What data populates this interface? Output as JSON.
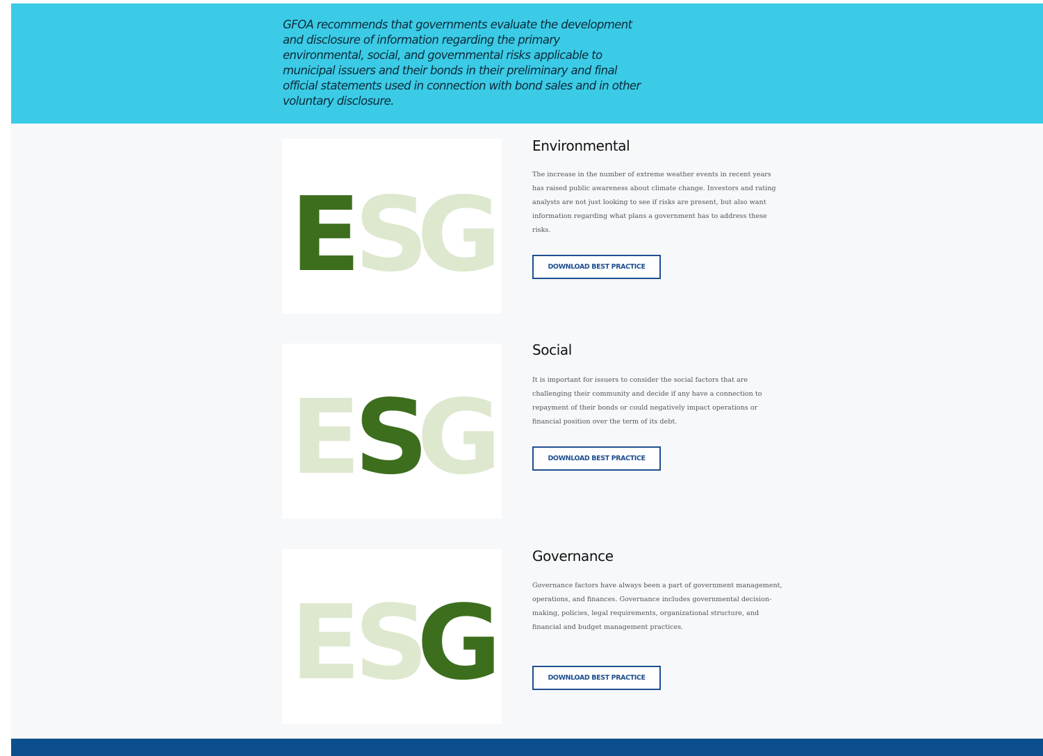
{
  "banner": {
    "text": "GFOA recommends that governments evaluate the development and disclosure of information regarding the primary environmental, social, and governmental risks applicable to municipal issuers and their bonds in their preliminary and final official statements used in connection with bond sales and in other voluntary disclosure."
  },
  "colors": {
    "banner_bg": "#3bcbe6",
    "content_bg": "#f6f8fa",
    "footer_bg": "#0c4f8c",
    "button_border": "#1e4f8f",
    "leaf_dark": "#3d6e1e",
    "leaf_light": "#dde8cf"
  },
  "sections": [
    {
      "title": "Environmental",
      "body": "The increase in the number of extreme weather events in recent years has raised public awareness about climate change. Investors and rating analysts are not just looking to see if risks are present, but also want information regarding what plans a government has to address these risks.",
      "button_label": "DOWNLOAD BEST PRACTICE",
      "image": {
        "letters": [
          "E",
          "S",
          "G"
        ],
        "highlighted_letter": "E"
      }
    },
    {
      "title": "Social",
      "body": "It is important for issuers to consider the social factors that are challenging their community and decide if any have a connection to repayment of their bonds or could negatively impact operations or financial position over the term of its debt.",
      "button_label": "DOWNLOAD BEST PRACTICE",
      "image": {
        "letters": [
          "E",
          "S",
          "G"
        ],
        "highlighted_letter": "S"
      }
    },
    {
      "title": "Governance",
      "body": "Governance factors have always been a part of government management, operations, and finances. Governance includes governmental decision-making, policies, legal requirements, organizational structure, and financial and budget management practices.",
      "button_label": "DOWNLOAD BEST PRACTICE",
      "image": {
        "letters": [
          "E",
          "S",
          "G"
        ],
        "highlighted_letter": "G"
      }
    }
  ]
}
